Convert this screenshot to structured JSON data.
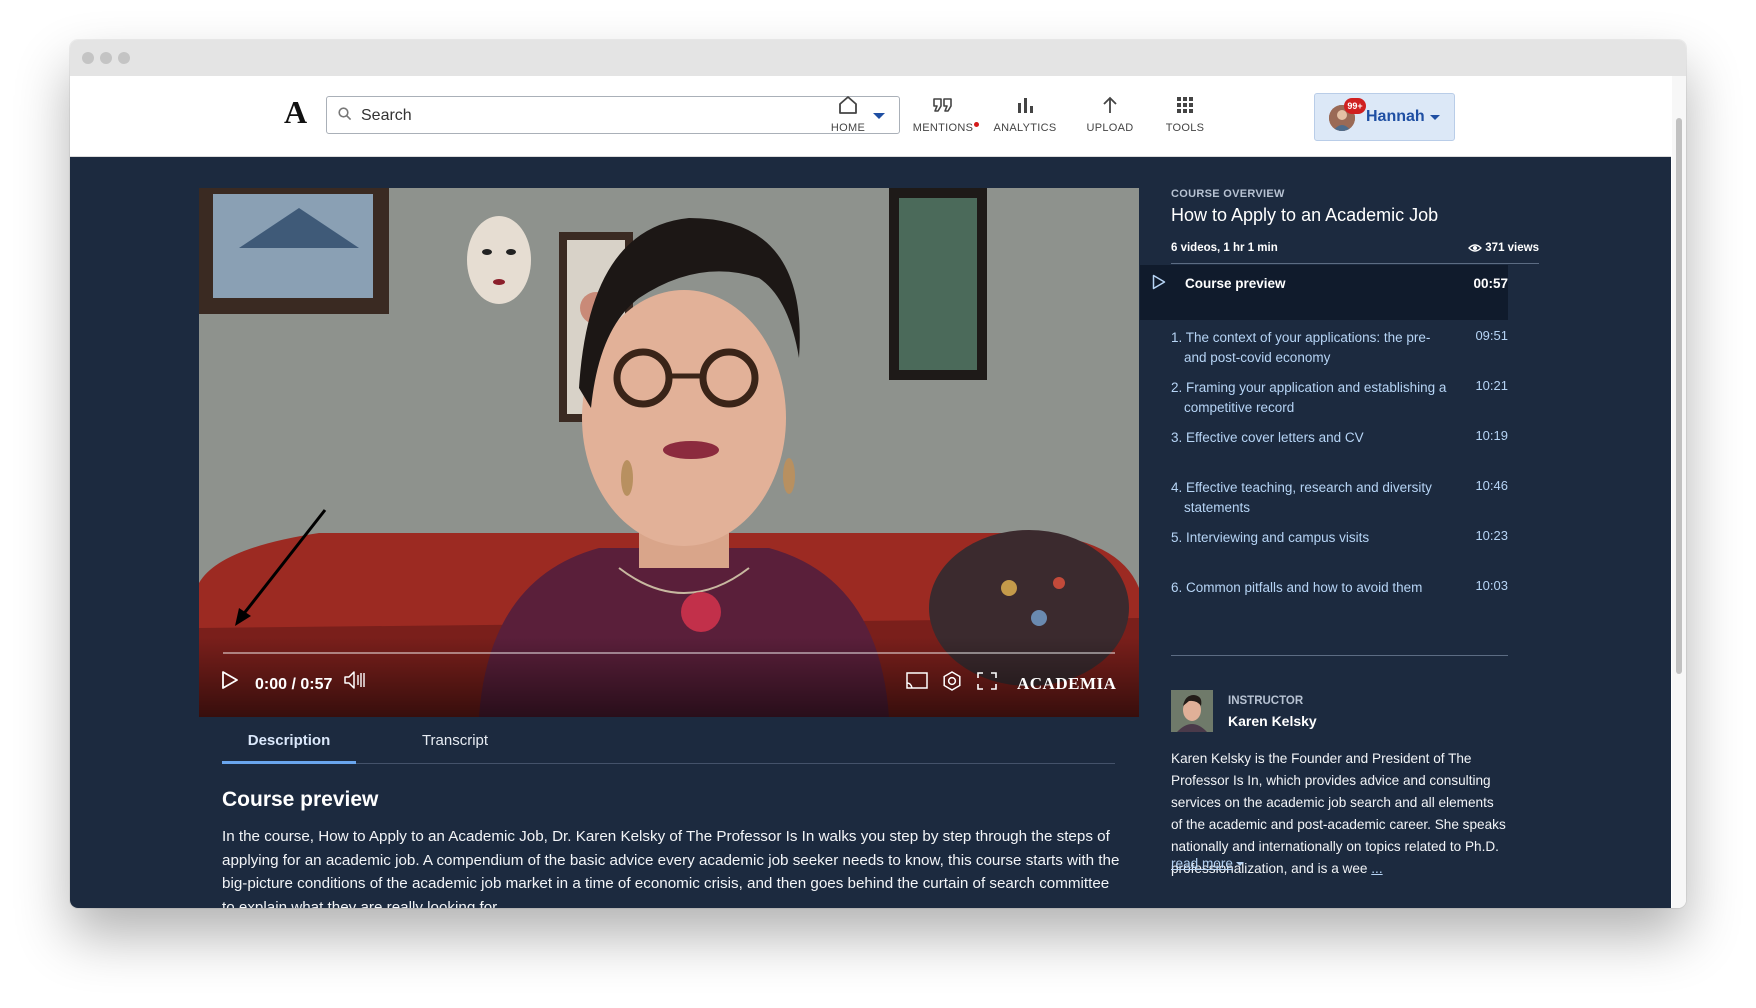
{
  "search": {
    "placeholder": "Search"
  },
  "nav": {
    "logo": "A",
    "home": "HOME",
    "mentions": "MENTIONS",
    "analytics": "ANALYTICS",
    "upload": "UPLOAD",
    "tools": "TOOLS"
  },
  "user": {
    "name": "Hannah",
    "badge": "99+"
  },
  "video": {
    "time": "0:00 / 0:57",
    "watermark": "ACADEMIA",
    "progress": 0
  },
  "tabs": {
    "description": "Description",
    "transcript": "Transcript",
    "active": "Description"
  },
  "description": {
    "title": "Course preview",
    "body": "In the course, How to Apply to an Academic Job, Dr. Karen Kelsky of The Professor Is In walks you step by step through the steps of applying for an academic job.  A compendium of the basic advice every academic job seeker needs to know, this course starts with the big-picture conditions of the academic job market in a time of economic crisis, and then goes behind the curtain of search committee to explain what they are really looking for."
  },
  "course": {
    "label": "COURSE OVERVIEW",
    "title": "How to Apply to an Academic Job",
    "meta": "6 videos, 1 hr 1 min",
    "views": "371 views",
    "preview": {
      "title": "Course preview",
      "duration": "00:57"
    },
    "lessons": [
      {
        "title": "1. The context of your applications: the pre- and post-covid economy",
        "duration": "09:51"
      },
      {
        "title": "2. Framing your application and establishing a competitive record",
        "duration": "10:21"
      },
      {
        "title": "3. Effective cover letters and CV",
        "duration": "10:19"
      },
      {
        "title": "4. Effective teaching, research and diversity statements",
        "duration": "10:46"
      },
      {
        "title": "5. Interviewing and campus visits",
        "duration": "10:23"
      },
      {
        "title": "6. Common pitfalls and how to avoid them",
        "duration": "10:03"
      }
    ]
  },
  "instructor": {
    "label": "INSTRUCTOR",
    "name": "Karen Kelsky",
    "bio": "Karen Kelsky is the Founder and President of The Professor Is In, which provides advice and consulting services on the academic job search and all elements of the academic and post-academic career. She speaks nationally and internationally on topics related to Ph.D. professionalization, and is a wee",
    "bio_ellipsis": "...",
    "read_more": "read more"
  },
  "colors": {
    "page_bg": "#1c2a3f",
    "accent_blue": "#1f4fa3",
    "link_blue": "#b6d4f5",
    "tab_underline": "#6aa6ee",
    "badge_red": "#d02020"
  }
}
